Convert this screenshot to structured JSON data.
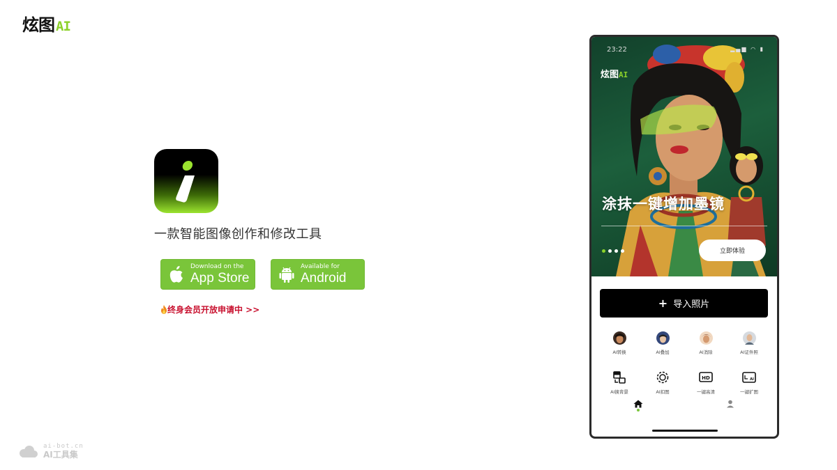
{
  "brand": {
    "name": "炫图",
    "ai": "AI",
    "accent": "#8cd12a"
  },
  "promo": {
    "tagline": "一款智能图像创作和修改工具",
    "app_store": {
      "small": "Download on the",
      "big": "App Store"
    },
    "android": {
      "small": "Available for",
      "big": "Android"
    },
    "lifetime_link": "终身会员开放申请中 >>",
    "button_color": "#7ac53a",
    "link_color": "#c8102e"
  },
  "phone": {
    "status_time": "23:22",
    "hero_logo": {
      "name": "炫图",
      "ai": "AI"
    },
    "hero_title": "涂抹一键增加墨镜",
    "try_button": "立即体验",
    "import_button": "导入照片",
    "features_row1": [
      {
        "label": "AI转换",
        "icon": "avatar-icon",
        "color": "#7a4a2a"
      },
      {
        "label": "AI叠加",
        "icon": "avatar-icon",
        "color": "#3b4f7a"
      },
      {
        "label": "AI消除",
        "icon": "avatar-icon",
        "color": "#c98a5a"
      },
      {
        "label": "AI证件照",
        "icon": "avatar-icon",
        "color": "#9aa0a6"
      }
    ],
    "features_row2": [
      {
        "label": "AI换背景",
        "icon": "swap-background-icon"
      },
      {
        "label": "AI扣图",
        "icon": "cutout-icon"
      },
      {
        "label": "一键高清",
        "icon": "hd-icon"
      },
      {
        "label": "一键扩图",
        "icon": "expand-ai-icon"
      }
    ],
    "tabs": [
      {
        "name": "home",
        "icon": "home-icon"
      },
      {
        "name": "profile",
        "icon": "user-icon"
      }
    ]
  },
  "watermark": {
    "url": "ai-bot.cn",
    "name": "AI工具集"
  }
}
